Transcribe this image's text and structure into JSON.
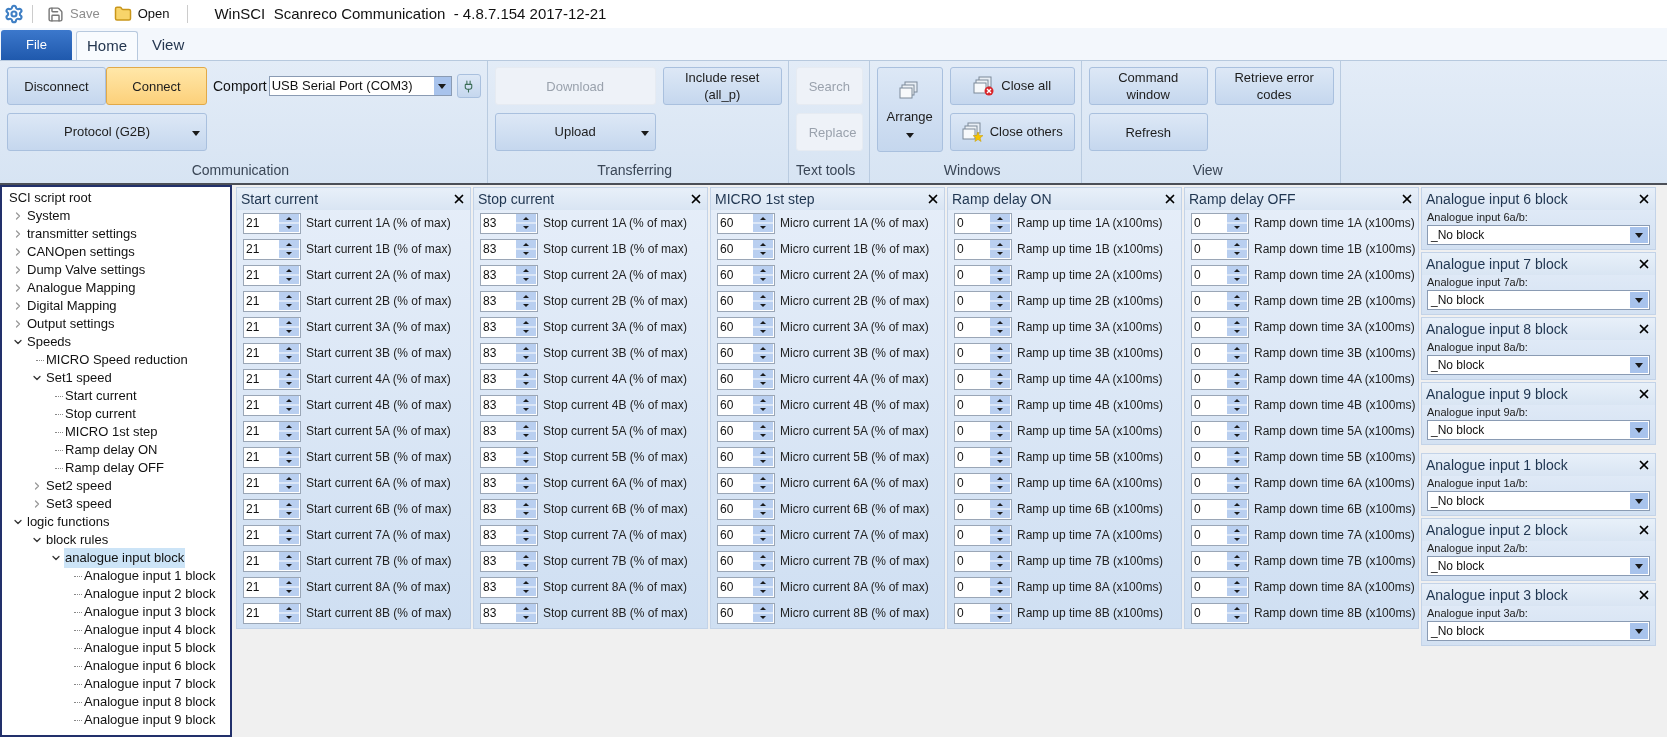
{
  "title_bar": {
    "title": "WinSCI  Scanreco Communication  - 4.8.7.154 2017-12-21",
    "quick_access": [
      {
        "label": "Save",
        "disabled": true
      },
      {
        "label": "Open",
        "disabled": false
      }
    ]
  },
  "tabs": [
    {
      "label": "File",
      "kind": "file",
      "selected": false
    },
    {
      "label": "Home",
      "kind": "tab",
      "selected": true
    },
    {
      "label": "View",
      "kind": "tab",
      "selected": false
    }
  ],
  "ribbon": [
    {
      "label": "Communication",
      "columns": [
        [
          [
            {
              "kind": "button",
              "label": "Disconnect",
              "disabled": false,
              "highlighted": false
            },
            {
              "kind": "button",
              "label": "Connect",
              "disabled": false,
              "highlighted": true
            },
            {
              "kind": "label",
              "label": "Comport"
            },
            {
              "kind": "combo",
              "value": "USB Serial Port (COM3)"
            },
            {
              "kind": "tool"
            }
          ],
          [
            {
              "kind": "dropdown",
              "label": "Protocol (G2B)",
              "disabled": false,
              "highlighted": false
            }
          ]
        ]
      ]
    },
    {
      "label": "Transferring",
      "columns": [
        [
          [
            {
              "kind": "button",
              "label": "Download",
              "disabled": true,
              "highlighted": false
            }
          ],
          [
            {
              "kind": "dropdown",
              "label": "Upload",
              "disabled": false,
              "highlighted": false
            }
          ]
        ],
        [
          [
            {
              "kind": "button",
              "label": "Include reset (all_p)",
              "disabled": false,
              "highlighted": false
            }
          ]
        ]
      ]
    },
    {
      "label": "Text tools",
      "columns": [
        [
          [
            {
              "kind": "button",
              "label": "Search",
              "disabled": true,
              "highlighted": false
            }
          ],
          [
            {
              "kind": "button",
              "label": "Replace",
              "disabled": true,
              "highlighted": false
            }
          ]
        ]
      ]
    },
    {
      "label": "Windows",
      "columns": [
        [
          [
            {
              "kind": "large",
              "label": "Arrange",
              "disabled": false,
              "highlighted": false
            }
          ]
        ],
        [
          [
            {
              "kind": "icon",
              "label": "Close all",
              "disabled": false,
              "highlighted": false
            }
          ],
          [
            {
              "kind": "icon",
              "label": "Close others",
              "disabled": false,
              "highlighted": false
            }
          ]
        ]
      ]
    },
    {
      "label": "View",
      "columns": [
        [
          [
            {
              "kind": "button",
              "label": "Command window",
              "disabled": false,
              "highlighted": false
            }
          ],
          [
            {
              "kind": "button",
              "label": "Refresh",
              "disabled": false,
              "highlighted": false
            }
          ]
        ],
        [
          [
            {
              "kind": "button",
              "label": "Retrieve error codes",
              "disabled": false,
              "highlighted": false
            }
          ]
        ]
      ]
    }
  ],
  "tree": {
    "items": [
      {
        "label": "SCI script root",
        "selected": false,
        "children": [
          {
            "label": "System",
            "selected": false,
            "expanded": false
          },
          {
            "label": "transmitter settings",
            "selected": false,
            "expanded": false
          },
          {
            "label": "CANOpen settings",
            "selected": false,
            "expanded": false
          },
          {
            "label": "Dump Valve settings",
            "selected": false,
            "expanded": false
          },
          {
            "label": "Analogue Mapping",
            "selected": false,
            "expanded": false
          },
          {
            "label": "Digital Mapping",
            "selected": false,
            "expanded": false
          },
          {
            "label": "Output settings",
            "selected": false,
            "expanded": false
          },
          {
            "label": "Speeds",
            "selected": false,
            "expanded": true,
            "children": [
              {
                "label": "MICRO Speed reduction",
                "selected": false
              },
              {
                "label": "Set1 speed",
                "selected": false,
                "expanded": true,
                "children": [
                  {
                    "label": "Start current",
                    "selected": false
                  },
                  {
                    "label": "Stop current",
                    "selected": false
                  },
                  {
                    "label": "MICRO 1st step",
                    "selected": false
                  },
                  {
                    "label": "Ramp delay ON",
                    "selected": false
                  },
                  {
                    "label": "Ramp delay OFF",
                    "selected": false
                  }
                ]
              },
              {
                "label": "Set2 speed",
                "selected": false,
                "expanded": false
              },
              {
                "label": "Set3 speed",
                "selected": false,
                "expanded": false
              }
            ]
          },
          {
            "label": "logic functions",
            "selected": false,
            "expanded": true,
            "children": [
              {
                "label": "block rules",
                "selected": false,
                "expanded": true,
                "children": [
                  {
                    "label": "analogue input block",
                    "selected": true,
                    "expanded": true,
                    "children": [
                      {
                        "label": "Analogue input 1 block",
                        "selected": false
                      },
                      {
                        "label": "Analogue input 2 block",
                        "selected": false
                      },
                      {
                        "label": "Analogue input 3 block",
                        "selected": false
                      },
                      {
                        "label": "Analogue input 4 block",
                        "selected": false
                      },
                      {
                        "label": "Analogue input 5 block",
                        "selected": false
                      },
                      {
                        "label": "Analogue input 6 block",
                        "selected": false
                      },
                      {
                        "label": "Analogue input 7 block",
                        "selected": false
                      },
                      {
                        "label": "Analogue input 8 block",
                        "selected": false
                      },
                      {
                        "label": "Analogue input 9 block",
                        "selected": false
                      }
                    ]
                  }
                ]
              }
            ]
          }
        ]
      }
    ]
  },
  "spin_panels": [
    {
      "title": "Start current",
      "rows": [
        {
          "value": "21",
          "label": "Start current 1A (% of max)"
        },
        {
          "value": "21",
          "label": "Start current 1B (% of max)"
        },
        {
          "value": "21",
          "label": "Start current 2A (% of max)"
        },
        {
          "value": "21",
          "label": "Start current 2B (% of max)"
        },
        {
          "value": "21",
          "label": "Start current 3A (% of max)"
        },
        {
          "value": "21",
          "label": "Start current 3B (% of max)"
        },
        {
          "value": "21",
          "label": "Start current 4A (% of max)"
        },
        {
          "value": "21",
          "label": "Start current 4B (% of max)"
        },
        {
          "value": "21",
          "label": "Start current 5A (% of max)"
        },
        {
          "value": "21",
          "label": "Start current 5B (% of max)"
        },
        {
          "value": "21",
          "label": "Start current 6A (% of max)"
        },
        {
          "value": "21",
          "label": "Start current 6B (% of max)"
        },
        {
          "value": "21",
          "label": "Start current 7A (% of max)"
        },
        {
          "value": "21",
          "label": "Start current 7B (% of max)"
        },
        {
          "value": "21",
          "label": "Start current 8A (% of max)"
        },
        {
          "value": "21",
          "label": "Start current 8B (% of max)"
        }
      ]
    },
    {
      "title": "Stop current",
      "rows": [
        {
          "value": "83",
          "label": "Stop current 1A (% of max)"
        },
        {
          "value": "83",
          "label": "Stop current 1B (% of max)"
        },
        {
          "value": "83",
          "label": "Stop current 2A (% of max)"
        },
        {
          "value": "83",
          "label": "Stop current 2B (% of max)"
        },
        {
          "value": "83",
          "label": "Stop current 3A (% of max)"
        },
        {
          "value": "83",
          "label": "Stop current 3B (% of max)"
        },
        {
          "value": "83",
          "label": "Stop current 4A (% of max)"
        },
        {
          "value": "83",
          "label": "Stop current 4B (% of max)"
        },
        {
          "value": "83",
          "label": "Stop current 5A (% of max)"
        },
        {
          "value": "83",
          "label": "Stop current 5B (% of max)"
        },
        {
          "value": "83",
          "label": "Stop current 6A (% of max)"
        },
        {
          "value": "83",
          "label": "Stop current 6B (% of max)"
        },
        {
          "value": "83",
          "label": "Stop current 7A (% of max)"
        },
        {
          "value": "83",
          "label": "Stop current 7B (% of max)"
        },
        {
          "value": "83",
          "label": "Stop current 8A (% of max)"
        },
        {
          "value": "83",
          "label": "Stop current 8B (% of max)"
        }
      ]
    },
    {
      "title": "MICRO 1st step",
      "rows": [
        {
          "value": "60",
          "label": "Micro current 1A (% of max)"
        },
        {
          "value": "60",
          "label": "Micro current 1B (% of max)"
        },
        {
          "value": "60",
          "label": "Micro current 2A (% of max)"
        },
        {
          "value": "60",
          "label": "Micro current 2B (% of max)"
        },
        {
          "value": "60",
          "label": "Micro current 3A (% of max)"
        },
        {
          "value": "60",
          "label": "Micro current 3B (% of max)"
        },
        {
          "value": "60",
          "label": "Micro current 4A (% of max)"
        },
        {
          "value": "60",
          "label": "Micro current 4B (% of max)"
        },
        {
          "value": "60",
          "label": "Micro current 5A (% of max)"
        },
        {
          "value": "60",
          "label": "Micro current 5B (% of max)"
        },
        {
          "value": "60",
          "label": "Micro current 6A (% of max)"
        },
        {
          "value": "60",
          "label": "Micro current 6B (% of max)"
        },
        {
          "value": "60",
          "label": "Micro current 7A (% of max)"
        },
        {
          "value": "60",
          "label": "Micro current 7B (% of max)"
        },
        {
          "value": "60",
          "label": "Micro current 8A (% of max)"
        },
        {
          "value": "60",
          "label": "Micro current 8B (% of max)"
        }
      ]
    },
    {
      "title": "Ramp delay ON",
      "rows": [
        {
          "value": "0",
          "label": "Ramp up time 1A (x100ms)"
        },
        {
          "value": "0",
          "label": "Ramp up time 1B (x100ms)"
        },
        {
          "value": "0",
          "label": "Ramp up time 2A (x100ms)"
        },
        {
          "value": "0",
          "label": "Ramp up time 2B (x100ms)"
        },
        {
          "value": "0",
          "label": "Ramp up time 3A (x100ms)"
        },
        {
          "value": "0",
          "label": "Ramp up time 3B (x100ms)"
        },
        {
          "value": "0",
          "label": "Ramp up time 4A (x100ms)"
        },
        {
          "value": "0",
          "label": "Ramp up time 4B (x100ms)"
        },
        {
          "value": "0",
          "label": "Ramp up time 5A (x100ms)"
        },
        {
          "value": "0",
          "label": "Ramp up time 5B (x100ms)"
        },
        {
          "value": "0",
          "label": "Ramp up time 6A (x100ms)"
        },
        {
          "value": "0",
          "label": "Ramp up time 6B (x100ms)"
        },
        {
          "value": "0",
          "label": "Ramp up time 7A (x100ms)"
        },
        {
          "value": "0",
          "label": "Ramp up time 7B (x100ms)"
        },
        {
          "value": "0",
          "label": "Ramp up time 8A (x100ms)"
        },
        {
          "value": "0",
          "label": "Ramp up time 8B (x100ms)"
        }
      ]
    },
    {
      "title": "Ramp delay OFF",
      "rows": [
        {
          "value": "0",
          "label": "Ramp down time 1A (x100ms)"
        },
        {
          "value": "0",
          "label": "Ramp down time 1B (x100ms)"
        },
        {
          "value": "0",
          "label": "Ramp down time 2A (x100ms)"
        },
        {
          "value": "0",
          "label": "Ramp down time 2B (x100ms)"
        },
        {
          "value": "0",
          "label": "Ramp down time 3A (x100ms)"
        },
        {
          "value": "0",
          "label": "Ramp down time 3B (x100ms)"
        },
        {
          "value": "0",
          "label": "Ramp down time 4A (x100ms)"
        },
        {
          "value": "0",
          "label": "Ramp down time 4B (x100ms)"
        },
        {
          "value": "0",
          "label": "Ramp down time 5A (x100ms)"
        },
        {
          "value": "0",
          "label": "Ramp down time 5B (x100ms)"
        },
        {
          "value": "0",
          "label": "Ramp down time 6A (x100ms)"
        },
        {
          "value": "0",
          "label": "Ramp down time 6B (x100ms)"
        },
        {
          "value": "0",
          "label": "Ramp down time 7A (x100ms)"
        },
        {
          "value": "0",
          "label": "Ramp down time 7B (x100ms)"
        },
        {
          "value": "0",
          "label": "Ramp down time 8A (x100ms)"
        },
        {
          "value": "0",
          "label": "Ramp down time 8B (x100ms)"
        }
      ]
    }
  ],
  "block_panels": [
    {
      "title": "Analogue input 6 block",
      "field_label": "Analogue input 6a/b:",
      "value": "_No block"
    },
    {
      "title": "Analogue input 7 block",
      "field_label": "Analogue input 7a/b:",
      "value": "_No block"
    },
    {
      "title": "Analogue input 8 block",
      "field_label": "Analogue input 8a/b:",
      "value": "_No block"
    },
    {
      "title": "Analogue input 9 block",
      "field_label": "Analogue input 9a/b:",
      "value": "_No block"
    },
    {
      "title": "Analogue input 1 block",
      "field_label": "Analogue input 1a/b:",
      "value": "_No block"
    },
    {
      "title": "Analogue input 2 block",
      "field_label": "Analogue input 2a/b:",
      "value": "_No block"
    },
    {
      "title": "Analogue input 3 block",
      "field_label": "Analogue input 3a/b:",
      "value": "_No block"
    }
  ]
}
